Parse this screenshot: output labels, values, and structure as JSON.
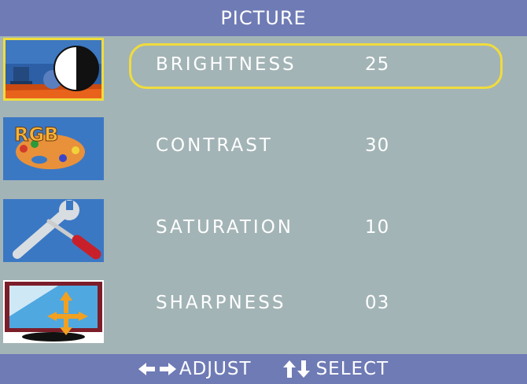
{
  "title": "PICTURE",
  "sidebar": {
    "items": [
      {
        "name": "picture",
        "icon": "picture-icon",
        "selected": true
      },
      {
        "name": "color",
        "icon": "rgb-palette-icon",
        "selected": false
      },
      {
        "name": "setup",
        "icon": "tools-icon",
        "selected": false
      },
      {
        "name": "display",
        "icon": "screen-position-icon",
        "selected": false
      }
    ]
  },
  "menu": {
    "items": [
      {
        "label": "BRIGHTNESS",
        "value": "25",
        "selected": true
      },
      {
        "label": "CONTRAST",
        "value": "30",
        "selected": false
      },
      {
        "label": "SATURATION",
        "value": "10",
        "selected": false
      },
      {
        "label": "SHARPNESS",
        "value": "03",
        "selected": false
      }
    ]
  },
  "footer": {
    "adjust_label": "ADJUST",
    "adjust_icon": "left-right-arrows-icon",
    "select_label": "SELECT",
    "select_icon": "up-down-arrows-icon"
  },
  "colors": {
    "background": "#a3b4b6",
    "bars": "#6f7bb5",
    "highlight": "#f0dc3c",
    "text": "#ffffff"
  }
}
